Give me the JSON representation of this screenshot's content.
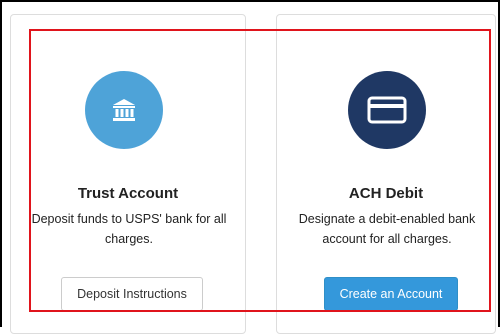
{
  "colors": {
    "trust_icon_bg": "#4ea3d8",
    "ach_icon_bg": "#1f3864",
    "primary_button": "#3498db",
    "highlight_box": "#e0141c"
  },
  "cards": {
    "trust": {
      "icon": "bank-icon",
      "title": "Trust Account",
      "description": "Deposit funds to USPS' bank for all charges.",
      "button_label": "Deposit Instructions"
    },
    "ach": {
      "icon": "credit-card-icon",
      "title": "ACH Debit",
      "description": "Designate a debit-enabled bank account for all charges.",
      "button_label": "Create an Account"
    }
  }
}
